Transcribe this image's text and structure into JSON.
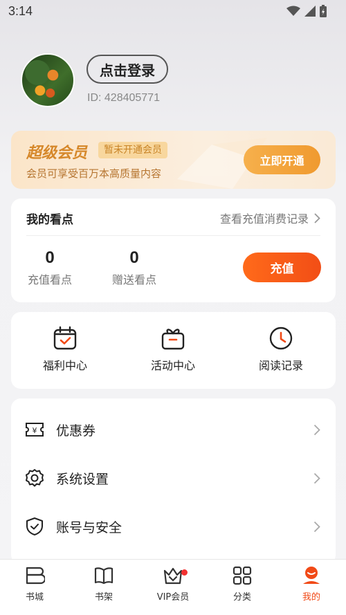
{
  "status": {
    "time": "3:14"
  },
  "profile": {
    "login_label": "点击登录",
    "user_id": "ID: 428405771"
  },
  "vip": {
    "title": "超级会员",
    "tag": "暂未开通会员",
    "description": "会员可享受百万本高质量内容",
    "button": "立即开通"
  },
  "points": {
    "title": "我的看点",
    "history_link": "查看充值消费记录",
    "stats": [
      {
        "value": "0",
        "label": "充值看点"
      },
      {
        "value": "0",
        "label": "赠送看点"
      }
    ],
    "recharge_button": "充值"
  },
  "shortcuts": [
    {
      "label": "福利中心",
      "icon": "calendar-check-icon"
    },
    {
      "label": "活动中心",
      "icon": "gift-icon"
    },
    {
      "label": "阅读记录",
      "icon": "clock-icon"
    }
  ],
  "menu": [
    {
      "label": "优惠券",
      "icon": "coupon-icon"
    },
    {
      "label": "系统设置",
      "icon": "gear-icon"
    },
    {
      "label": "账号与安全",
      "icon": "shield-icon"
    }
  ],
  "nav": [
    {
      "label": "书城",
      "icon": "bookstore-icon"
    },
    {
      "label": "书架",
      "icon": "book-icon"
    },
    {
      "label": "VIP会员",
      "icon": "vip-crown-icon"
    },
    {
      "label": "分类",
      "icon": "grid-icon"
    },
    {
      "label": "我的",
      "icon": "profile-icon",
      "active": true
    }
  ],
  "colors": {
    "accent": "#f14a17",
    "vip_gold": "#d6882a"
  }
}
